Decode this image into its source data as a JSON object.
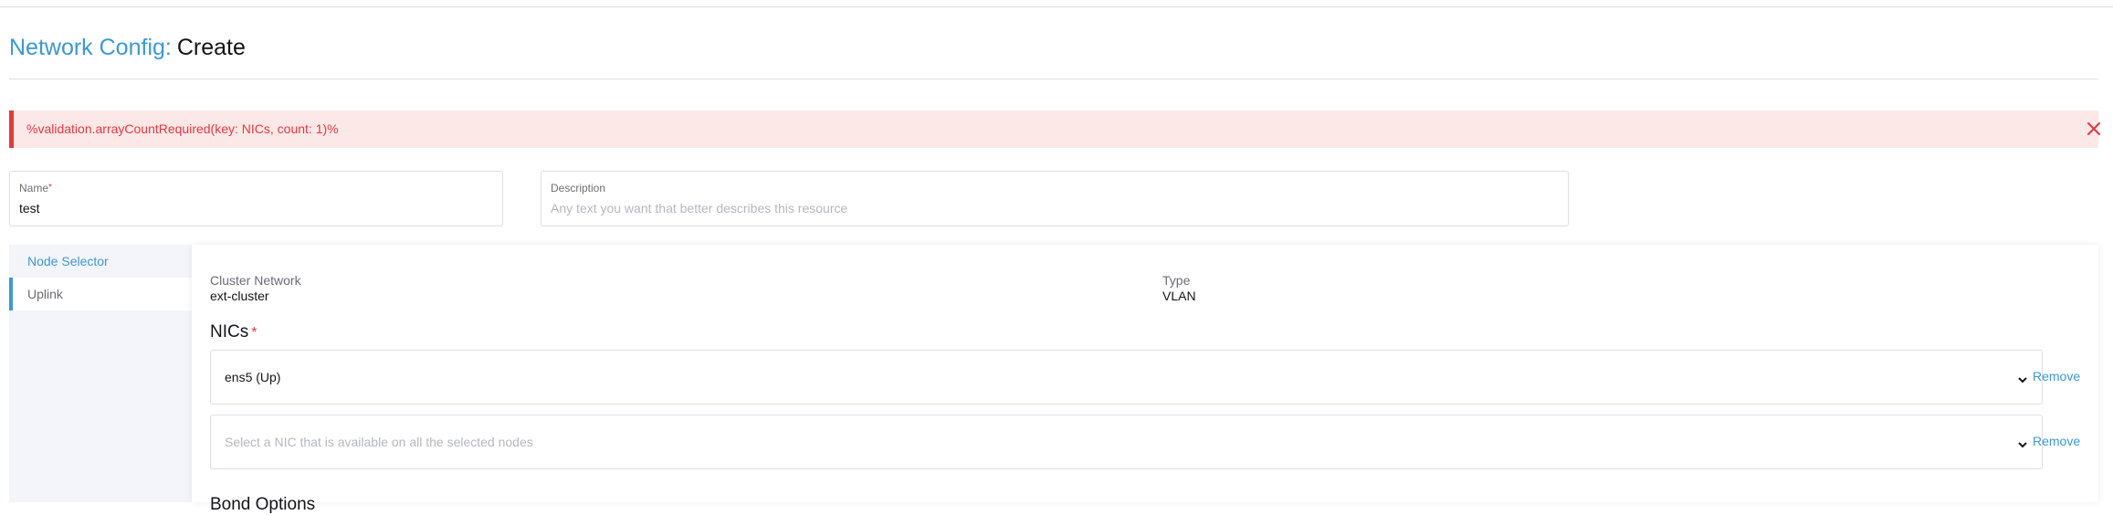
{
  "header": {
    "title_resource": "Network Config",
    "title_separator": ":",
    "title_mode": "Create"
  },
  "banner": {
    "message": "%validation.arrayCountRequired(key: NICs, count: 1)%",
    "close_icon": "close-icon"
  },
  "form": {
    "name": {
      "label": "Name",
      "required_marker": "*",
      "value": "test"
    },
    "description": {
      "label": "Description",
      "placeholder": "Any text you want that better describes this resource",
      "value": ""
    }
  },
  "sidebar": {
    "items": [
      {
        "label": "Node Selector",
        "state": "selected"
      },
      {
        "label": "Uplink",
        "state": "active"
      }
    ]
  },
  "main": {
    "cluster_network": {
      "label": "Cluster Network",
      "value": "ext-cluster"
    },
    "type": {
      "label": "Type",
      "value": "VLAN"
    },
    "nics": {
      "title": "NICs",
      "required_marker": "*",
      "rows": [
        {
          "value": "ens5 (Up)",
          "placeholder": "",
          "remove_label": "Remove"
        },
        {
          "value": "",
          "placeholder": "Select a NIC that is available on all the selected nodes",
          "remove_label": "Remove"
        }
      ]
    },
    "next_section_title_partial": "Bond Options"
  },
  "colors": {
    "accent": "#3d98d3",
    "error": "#e0393e",
    "error_bg": "#fde8e8",
    "border": "#dcdee7",
    "sidebar_bg": "#f4f5fa"
  }
}
